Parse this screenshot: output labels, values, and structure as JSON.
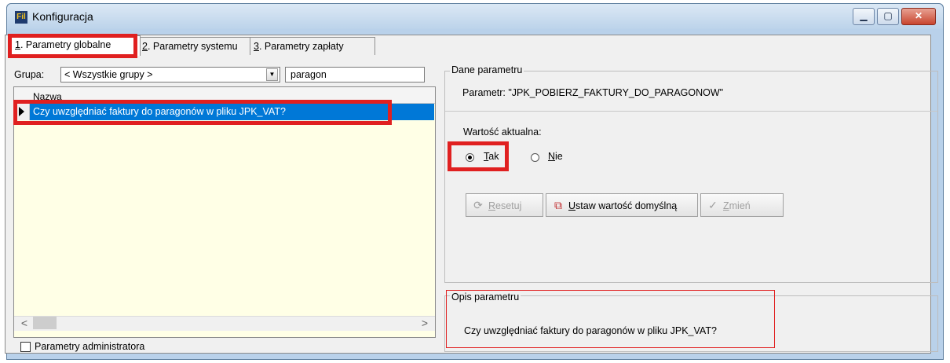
{
  "window": {
    "title": "Konfiguracja",
    "app_icon_text": "Fil",
    "buttons": {
      "minimize": "▁",
      "maximize": "▢",
      "close": "✕"
    }
  },
  "tabs": [
    {
      "num": "1",
      "label": ". Parametry globalne"
    },
    {
      "num": "2",
      "label": ". Parametry systemu"
    },
    {
      "num": "3",
      "label": ". Parametry zapłaty"
    }
  ],
  "left": {
    "group_label": "Grupa:",
    "group_value": "< Wszystkie grupy >",
    "search_value": "paragon",
    "grid_header": "Nazwa",
    "rows": [
      {
        "text": "Czy uwzględniać faktury do paragonów w pliku JPK_VAT?",
        "selected": true
      }
    ],
    "scroll_left": "<",
    "scroll_right": ">",
    "admin_label": "Parametry administratora"
  },
  "right": {
    "param_group_title": "Dane parametru",
    "param_label": "Parametr: \"JPK_POBIERZ_FAKTURY_DO_PARAGONOW\"",
    "current_value_label": "Wartość aktualna:",
    "option_yes": {
      "first": "T",
      "rest": "ak",
      "selected": true
    },
    "option_no": {
      "first": "N",
      "rest": "ie",
      "selected": false
    },
    "buttons": {
      "reset": {
        "first": "R",
        "rest": "esetuj",
        "icon": "⟳"
      },
      "default": {
        "first": "U",
        "rest": "staw wartość domyślną",
        "icon": "⧉"
      },
      "change": {
        "first": "Z",
        "rest": "mień",
        "icon": "✓"
      }
    },
    "desc_group_title": "Opis parametru",
    "description": "Czy uwzględniać faktury do paragonów w pliku JPK_VAT?"
  },
  "colors": {
    "selection": "#0078d7",
    "grid_bg": "#ffffe6",
    "highlight_red": "#e02020"
  }
}
